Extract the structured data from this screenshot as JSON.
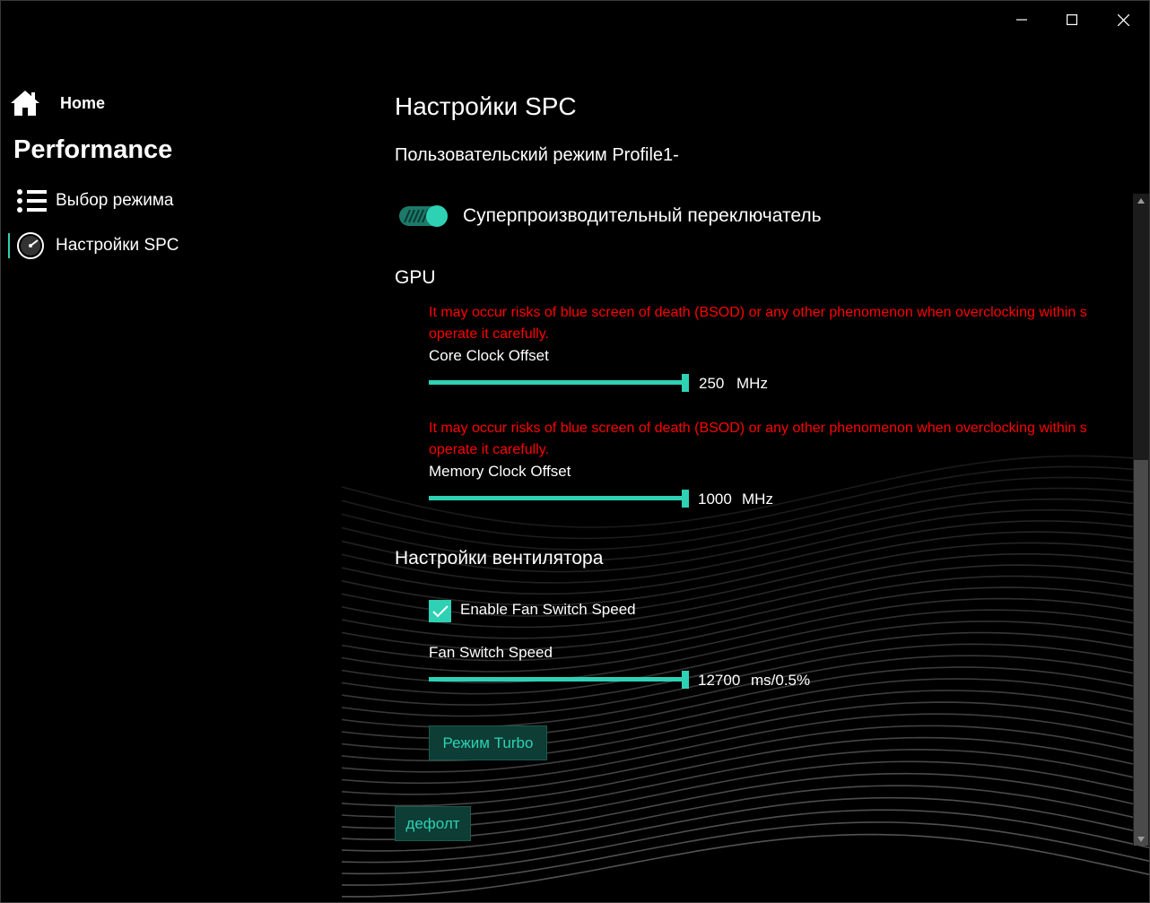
{
  "titlebar": {
    "minimize_icon": "minimize-icon",
    "maximize_icon": "maximize-icon",
    "close_icon": "close-icon"
  },
  "sidebar": {
    "home_label": "Home",
    "section_label": "Performance",
    "items": [
      {
        "label": "Выбор режима",
        "icon": "list-icon",
        "selected": false
      },
      {
        "label": "Настройки SPC",
        "icon": "gauge-icon",
        "selected": true
      }
    ]
  },
  "main": {
    "title": "Настройки SPC",
    "profile": "Пользовательский режим Profile1-",
    "super_switch": {
      "label": "Суперпроизводительный переключатель",
      "on": true
    },
    "gpu": {
      "heading": "GPU",
      "core": {
        "warning_line1": "It may occur risks of blue screen of death (BSOD) or any other phenomenon when overclocking within s",
        "warning_line2": "operate it carefully.",
        "label": "Core Clock Offset",
        "value": "250",
        "unit": "MHz",
        "fill": 1.0
      },
      "memory": {
        "warning_line1": "It may occur risks of blue screen of death (BSOD) or any other phenomenon when overclocking within s",
        "warning_line2": "operate it carefully.",
        "label": "Memory Clock Offset",
        "value": "1000",
        "unit": "MHz",
        "fill": 1.0
      }
    },
    "fan": {
      "heading": "Настройки вентилятора",
      "enable_label": "Enable Fan Switch Speed",
      "enabled": true,
      "speed_label": "Fan Switch Speed",
      "speed_value": "12700",
      "speed_unit": "ms/0.5%",
      "fill": 1.0,
      "turbo_button": "Режим Turbo"
    },
    "default_button": "дефолт"
  },
  "colors": {
    "accent": "#2ed1b4",
    "warning": "#ff0000",
    "background": "#000000",
    "button_bg": "#0d3d35"
  }
}
